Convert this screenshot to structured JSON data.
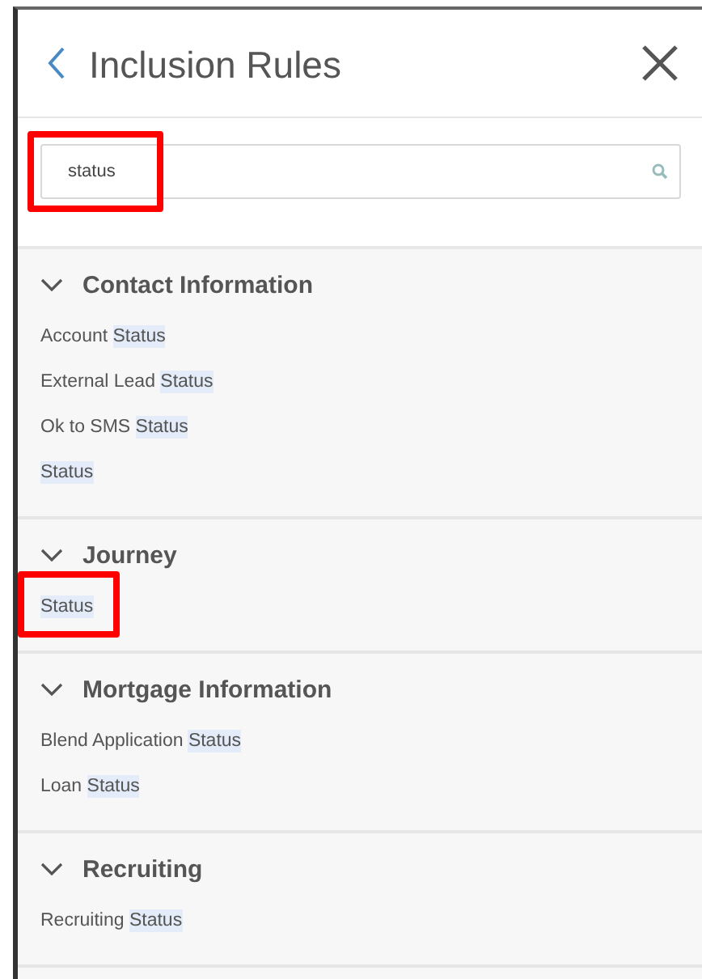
{
  "header": {
    "title": "Inclusion Rules"
  },
  "search": {
    "value": "status",
    "annotated": true
  },
  "sections": [
    {
      "title": "Contact Information",
      "expanded": true,
      "items": [
        {
          "prefix": "Account",
          "match": "Status",
          "annotated": false
        },
        {
          "prefix": "External Lead",
          "match": "Status",
          "annotated": false
        },
        {
          "prefix": "Ok to SMS",
          "match": "Status",
          "annotated": false
        },
        {
          "match": "Status",
          "annotated": false
        }
      ]
    },
    {
      "title": "Journey",
      "expanded": true,
      "items": [
        {
          "match": "Status",
          "annotated": true
        }
      ]
    },
    {
      "title": "Mortgage Information",
      "expanded": true,
      "items": [
        {
          "prefix": "Blend Application",
          "match": "Status",
          "annotated": false
        },
        {
          "prefix": "Loan",
          "match": "Status",
          "annotated": false
        }
      ]
    },
    {
      "title": "Recruiting",
      "expanded": true,
      "items": [
        {
          "prefix": "Recruiting",
          "match": "Status",
          "annotated": false
        }
      ]
    }
  ]
}
